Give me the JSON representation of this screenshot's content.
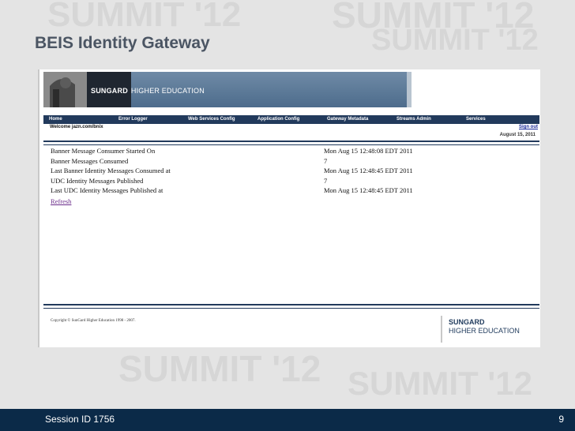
{
  "slide": {
    "title": "BEIS Identity Gateway",
    "session": "Session ID 1756",
    "page_number": "9",
    "watermark": "SUMMIT '12"
  },
  "app": {
    "brand_main": "SUNGARD",
    "brand_sub": "HIGHER EDUCATION",
    "nav": [
      {
        "label": "Home"
      },
      {
        "label": "Error Logger"
      },
      {
        "label": "Web Services Config"
      },
      {
        "label": "Application Config"
      },
      {
        "label": "Gateway Metadata"
      },
      {
        "label": "Streams Admin"
      },
      {
        "label": "Services"
      }
    ],
    "welcome": "Welcome jazn.com/bnix",
    "signout": "Sign out",
    "date": "August 15, 2011",
    "stats": [
      {
        "label": "Banner Message Consumer Started On",
        "value": "Mon Aug 15 12:48:08 EDT 2011"
      },
      {
        "label": "Banner Messages Consumed",
        "value": "7"
      },
      {
        "label": "Last Banner Identity Messages Consumed at",
        "value": "Mon Aug 15 12:48:45 EDT 2011"
      },
      {
        "label": "UDC Identity Messages Published",
        "value": "7"
      },
      {
        "label": "Last UDC Identity Messages Published at",
        "value": "Mon Aug 15 12:48:45 EDT 2011"
      }
    ],
    "refresh": "Refresh",
    "copyright": "Copyright © SunGard Higher Education 1998 - 2007.",
    "footer_brand_main": "SUNGARD",
    "footer_brand_sub": "HIGHER EDUCATION"
  },
  "colors": {
    "nav_bg": "#223a5c",
    "banner": "#5b7896",
    "bottom_bar": "#0b2a48",
    "link_visited": "#6a2c8a"
  }
}
